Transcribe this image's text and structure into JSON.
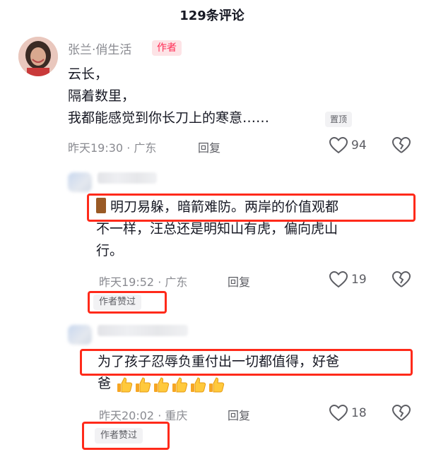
{
  "header": {
    "title": "129条评论"
  },
  "comments": [
    {
      "author": "张兰·俏生活",
      "author_tag": "作者",
      "lines": [
        "云长，",
        "隔着数里，",
        "我都能感觉到你长刀上的寒意……"
      ],
      "pin_tag": "置顶",
      "time": "昨天19:30",
      "location": "广东",
      "reply_label": "回复",
      "likes": "94"
    },
    {
      "lines": [
        "明刀易躲，暗箭难防。两岸的价值观都",
        "不一样，汪总还是明知山有虎，偏向虎山",
        "行。"
      ],
      "time": "昨天19:52",
      "location": "广东",
      "reply_label": "回复",
      "likes": "19",
      "liked_by_author": "作者赞过"
    },
    {
      "lines": [
        "为了孩子忍辱负重付出一切都值得，好爸",
        "爸"
      ],
      "emoji": "thumbs-up",
      "emoji_count": 6,
      "time": "昨天20:02",
      "location": "重庆",
      "reply_label": "回复",
      "likes": "18",
      "liked_by_author": "作者赞过"
    }
  ],
  "colors": {
    "accent": "#fe2c55",
    "highlight_box": "#ff2a1a",
    "secondary_text": "#8a8b91"
  }
}
